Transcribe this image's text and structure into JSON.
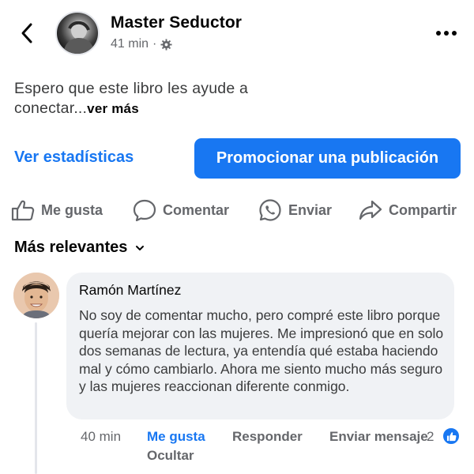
{
  "header": {
    "page_name": "Master Seductor",
    "time": "41 min",
    "separator": "·",
    "audience_icon": "gear-icon",
    "back_icon": "chevron-left-icon",
    "more_icon": "more-horizontal-icon"
  },
  "post": {
    "text": "Espero que este libro les ayude a conectar...",
    "see_more": "ver más"
  },
  "actions": {
    "stats_label": "Ver estadísticas",
    "promote_label": "Promocionar una publicación",
    "like_label": "Me gusta",
    "comment_label": "Comentar",
    "send_label": "Enviar",
    "share_label": "Compartir"
  },
  "comments_header": {
    "sort_label": "Más relevantes"
  },
  "comment": {
    "author": "Ramón Martínez",
    "text": "No soy de comentar mucho, pero compré este libro porque quería mejorar con las mujeres. Me impresionó que en solo dos semanas de lectura, ya entendía qué estaba haciendo mal y cómo cambiarlo. Ahora me siento mucho más seguro y las mujeres reaccionan diferente conmigo.",
    "time": "40 min",
    "like": "Me gusta",
    "reply": "Responder",
    "send_message": "Enviar mensaje",
    "reaction_count": "2",
    "hide": "Ocultar"
  },
  "colors": {
    "accent": "#1877f2",
    "muted": "#65676b",
    "bubble": "#f0f2f5"
  }
}
